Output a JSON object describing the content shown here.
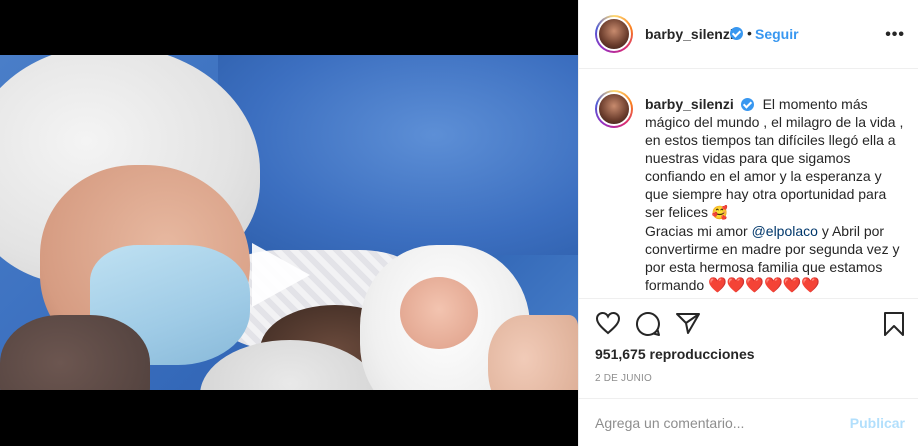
{
  "post": {
    "author": {
      "username": "barby_silenzi",
      "verified": true
    },
    "follow_label": "Seguir",
    "separator": "•",
    "more_label": "•••"
  },
  "caption": {
    "username": "barby_silenzi",
    "text_1": "El momento más mágico del mundo , el milagro de la vida , en estos tiempos tan difíciles llegó ella a nuestras vidas para que sigamos confiando en el amor y la esperanza y que siempre hay otra oportunidad para ser felices",
    "emoji_1": "🥰",
    "text_2": "Gracias mi amor",
    "mention": "@elpolaco",
    "text_3": "y Abril por convertirme en madre por segunda vez y por esta hermosa familia que estamos formando",
    "hearts": "❤️❤️❤️❤️❤️❤️"
  },
  "stats": {
    "views": "951,675 reproducciones",
    "date": "2 DE JUNIO"
  },
  "comment_box": {
    "placeholder": "Agrega un comentario...",
    "publish_label": "Publicar"
  },
  "icons": [
    "heart-icon",
    "comment-icon",
    "share-icon",
    "bookmark-icon",
    "play-icon",
    "sound-icon",
    "verified-icon"
  ],
  "colors": {
    "accent": "#3897f0",
    "text": "#262626",
    "muted": "#8e8e8e",
    "publish_disabled": "#b2dffc"
  }
}
